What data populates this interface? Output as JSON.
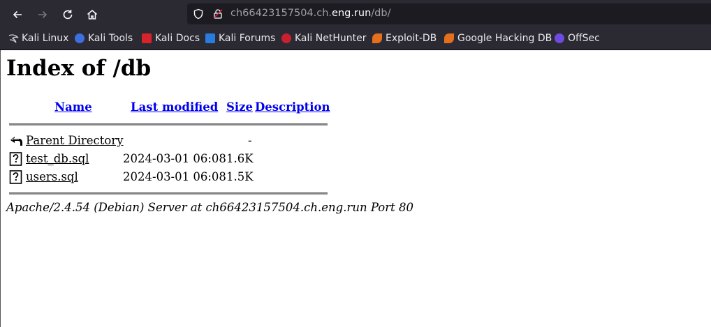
{
  "browser": {
    "url_prefix": "ch66423157504.ch.",
    "url_domain": "eng.run",
    "url_path": "/db/",
    "bookmarks": [
      {
        "label": "Kali Linux",
        "color": "#cfcfd8"
      },
      {
        "label": "Kali Tools",
        "color": "#3d6fe0"
      },
      {
        "label": "Kali Docs",
        "color": "#d8232a"
      },
      {
        "label": "Kali Forums",
        "color": "#2a7bde"
      },
      {
        "label": "Kali NetHunter",
        "color": "#c8202f"
      },
      {
        "label": "Exploit-DB",
        "color": "#e46f1d"
      },
      {
        "label": "Google Hacking DB",
        "color": "#e46f1d"
      },
      {
        "label": "OffSec",
        "color": "#6d4be0"
      }
    ]
  },
  "page": {
    "title": "Index of /db",
    "headers": {
      "name": "Name",
      "last_modified": "Last modified",
      "size": "Size",
      "description": "Description"
    },
    "parent": {
      "name": "Parent Directory",
      "size": "-"
    },
    "files": [
      {
        "name": "test_db.sql",
        "modified": "2024-03-01 06:08",
        "size": "1.6K"
      },
      {
        "name": "users.sql",
        "modified": "2024-03-01 06:08",
        "size": "1.5K"
      }
    ],
    "footer": "Apache/2.4.54 (Debian) Server at ch66423157504.ch.eng.run Port 80"
  }
}
